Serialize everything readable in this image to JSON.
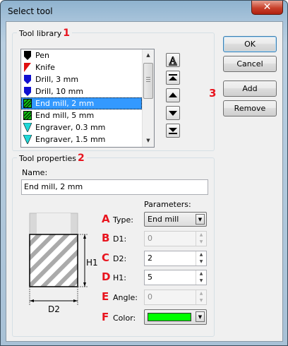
{
  "window": {
    "title": "Select tool",
    "close_glyph": "✕"
  },
  "library": {
    "legend": "Tool library",
    "marker": "1",
    "items": [
      {
        "label": "Pen",
        "icon": "pen-icon",
        "color": "#000000"
      },
      {
        "label": "Knife",
        "icon": "knife-icon",
        "color": "#e01010"
      },
      {
        "label": "Drill, 3 mm",
        "icon": "drill-icon",
        "color": "#1010d0"
      },
      {
        "label": "Drill, 10 mm",
        "icon": "drill-icon",
        "color": "#1010d0"
      },
      {
        "label": "End mill, 2 mm",
        "icon": "end-mill-icon",
        "color": "#10c010",
        "selected": true
      },
      {
        "label": "End mill, 5 mm",
        "icon": "end-mill-icon",
        "color": "#10c010"
      },
      {
        "label": "Engraver, 0.3 mm",
        "icon": "engraver-icon",
        "color": "#20d8d8"
      },
      {
        "label": "Engraver, 1.5 mm",
        "icon": "engraver-icon",
        "color": "#20d8d8"
      }
    ],
    "side_buttons": [
      "sort-alpha-icon",
      "move-top-icon",
      "move-up-icon",
      "move-down-icon",
      "move-bottom-icon"
    ],
    "sort_glyph": "A"
  },
  "buttons": {
    "ok": "OK",
    "cancel": "Cancel",
    "add": "Add",
    "remove": "Remove",
    "marker": "3"
  },
  "properties": {
    "legend": "Tool properties",
    "marker": "2",
    "name_label": "Name:",
    "name_value": "End mill, 2 mm",
    "parameters_label": "Parameters:",
    "type": {
      "marker": "A",
      "label": "Type:",
      "value": "End mill"
    },
    "d1": {
      "marker": "B",
      "label": "D1:",
      "value": "0",
      "enabled": false
    },
    "d2": {
      "marker": "C",
      "label": "D2:",
      "value": "2",
      "enabled": true
    },
    "h1": {
      "marker": "D",
      "label": "H1:",
      "value": "5",
      "enabled": true
    },
    "angle": {
      "marker": "E",
      "label": "Angle:",
      "value": "0",
      "enabled": false
    },
    "color": {
      "marker": "F",
      "label": "Color:",
      "value": "#00ff00"
    },
    "diagram": {
      "h_label": "H1",
      "d_label": "D2"
    }
  }
}
